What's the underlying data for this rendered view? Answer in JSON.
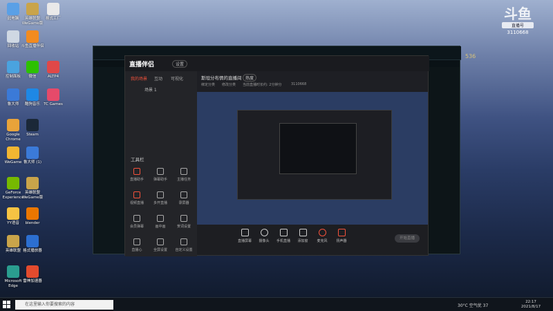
{
  "desktop": {
    "icons": [
      {
        "label": "此电脑",
        "color": "#5aa0e6"
      },
      {
        "label": "英雄联盟 WeGame版",
        "color": "#c9a44a"
      },
      {
        "label": "格式工厂",
        "color": "#e9e9e9"
      },
      {
        "label": "回收站",
        "color": "#cfd8e3"
      },
      {
        "label": "斗鱼直播伴侣",
        "color": "#f28b1f"
      },
      {
        "label": "控制面板",
        "color": "#4aa3df"
      },
      {
        "label": "微信",
        "color": "#2dc100"
      },
      {
        "label": "ALTP4",
        "color": "#e04848"
      },
      {
        "label": "鲁大师",
        "color": "#3b7ad8"
      },
      {
        "label": "酷狗音乐",
        "color": "#1e88e5"
      },
      {
        "label": "TC Games",
        "color": "#e64a6a"
      },
      {
        "label": "Google Chrome",
        "color": "#e8a33a"
      },
      {
        "label": "Steam",
        "color": "#1b2838"
      },
      {
        "label": "WeGame",
        "color": "#f2b632"
      },
      {
        "label": "鲁大师 (1)",
        "color": "#3b7ad8"
      },
      {
        "label": "GeForce Experience",
        "color": "#76b900"
      },
      {
        "label": "英雄联盟 WeGame版",
        "color": "#c9a44a"
      },
      {
        "label": "YY语音",
        "color": "#f6c343"
      },
      {
        "label": "blender",
        "color": "#ea7600"
      },
      {
        "label": "英雄联盟",
        "color": "#c9a44a"
      },
      {
        "label": "格式播放器",
        "color": "#2c6fd1"
      },
      {
        "label": "Microsoft Edge",
        "color": "#2a9d8f"
      },
      {
        "label": "雷神加速器",
        "color": "#e34b2e"
      }
    ]
  },
  "watermark": {
    "logo": "斗鱼",
    "sub": "直播号",
    "number": "3110668"
  },
  "lol": {
    "currency": "536"
  },
  "app": {
    "title": "直播伴侣",
    "badge": "设置",
    "tabs": [
      "我的场景",
      "互动",
      "可视化"
    ],
    "scene_label": "场景 1",
    "tools_title": "工具栏",
    "tools": [
      "直播助手",
      "弹幕助手",
      "主播任务",
      "视频直播",
      "多开直播",
      "录屏器",
      "会员弹幕",
      "画中画",
      "贺词设置",
      "直播心",
      "全屏设置",
      "自定义设置"
    ],
    "header_text": "斯坦分布情的直播间",
    "header_badge": "热度",
    "chips": [
      "绑定分类",
      "修改分类",
      "当前直播时长约: 2分钟分",
      "3110668"
    ],
    "bottom_buttons": [
      "直播屏幕",
      "摄像头",
      "手机直播",
      "添加窗",
      "麦克风",
      "扬声器"
    ],
    "start_live": "开始直播"
  },
  "taskbar": {
    "search_placeholder": "在这里输入你要搜索的内容",
    "weather": "30°C 空气优 37",
    "time": "22:17",
    "date": "2021/8/17"
  }
}
